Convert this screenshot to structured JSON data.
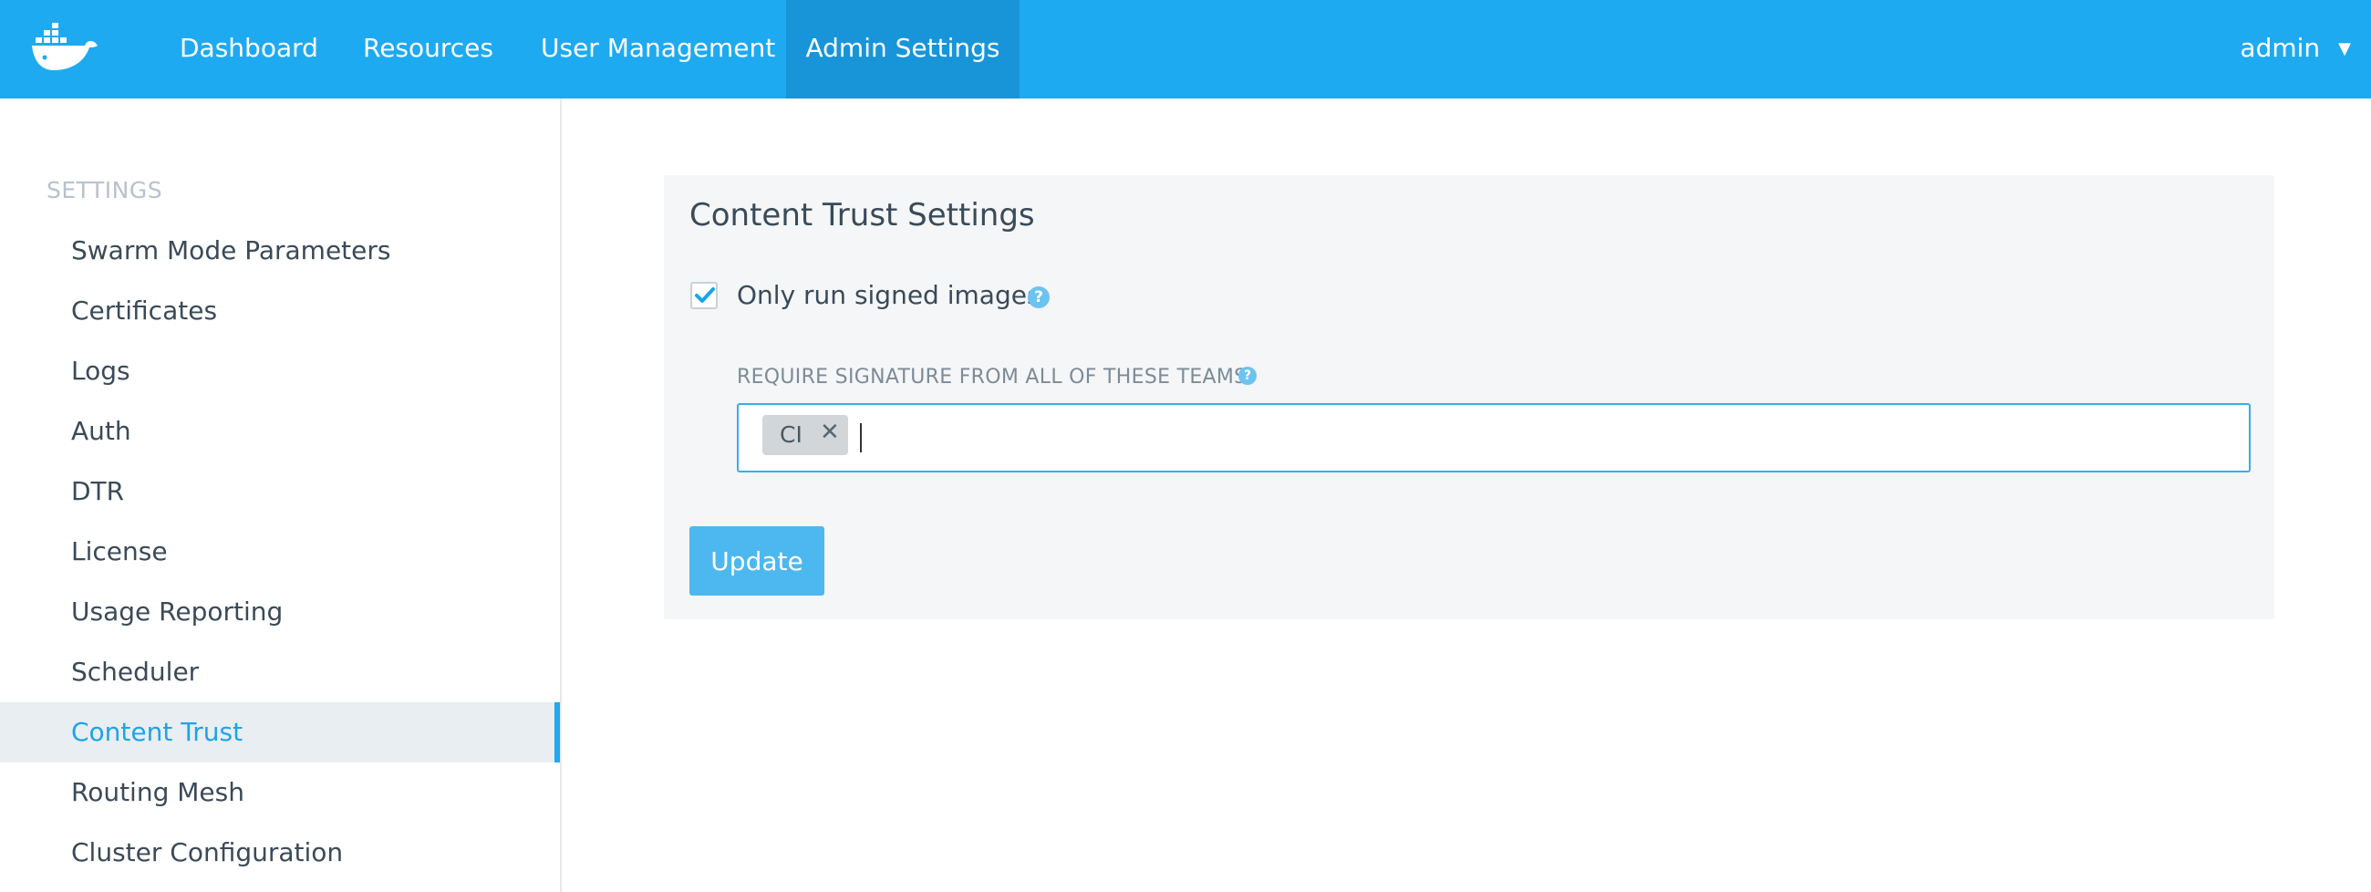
{
  "topnav": {
    "logo_icon": "docker-whale-icon",
    "items": [
      {
        "label": "Dashboard"
      },
      {
        "label": "Resources"
      },
      {
        "label": "User Management"
      },
      {
        "label": "Admin Settings"
      }
    ],
    "active_item": "Admin Settings",
    "user": {
      "label": "admin",
      "icon": "caret-down-icon"
    }
  },
  "sidebar": {
    "heading": "SETTINGS",
    "items": [
      {
        "label": "Swarm Mode Parameters"
      },
      {
        "label": "Certificates"
      },
      {
        "label": "Logs"
      },
      {
        "label": "Auth"
      },
      {
        "label": "DTR"
      },
      {
        "label": "License"
      },
      {
        "label": "Usage Reporting"
      },
      {
        "label": "Scheduler"
      },
      {
        "label": "Content Trust"
      },
      {
        "label": "Routing Mesh"
      },
      {
        "label": "Cluster Configuration"
      }
    ],
    "active_item": "Content Trust"
  },
  "content_trust": {
    "title": "Content Trust Settings",
    "signed_images": {
      "label": "Only run signed images",
      "checked": true,
      "help_icon": "question-circle-icon"
    },
    "teams_field": {
      "label": "REQUIRE SIGNATURE FROM ALL OF THESE TEAMS",
      "help_icon": "question-circle-icon",
      "tags": [
        {
          "label": "CI",
          "remove_icon": "close-x-icon"
        }
      ],
      "value": ""
    },
    "update_button": "Update"
  },
  "colors": {
    "topbar": "#1eaaf1",
    "topbar_active": "#1895d8",
    "accent": "#1eaaf1",
    "button": "#4db8f0",
    "panel_bg": "#f4f6f8"
  }
}
